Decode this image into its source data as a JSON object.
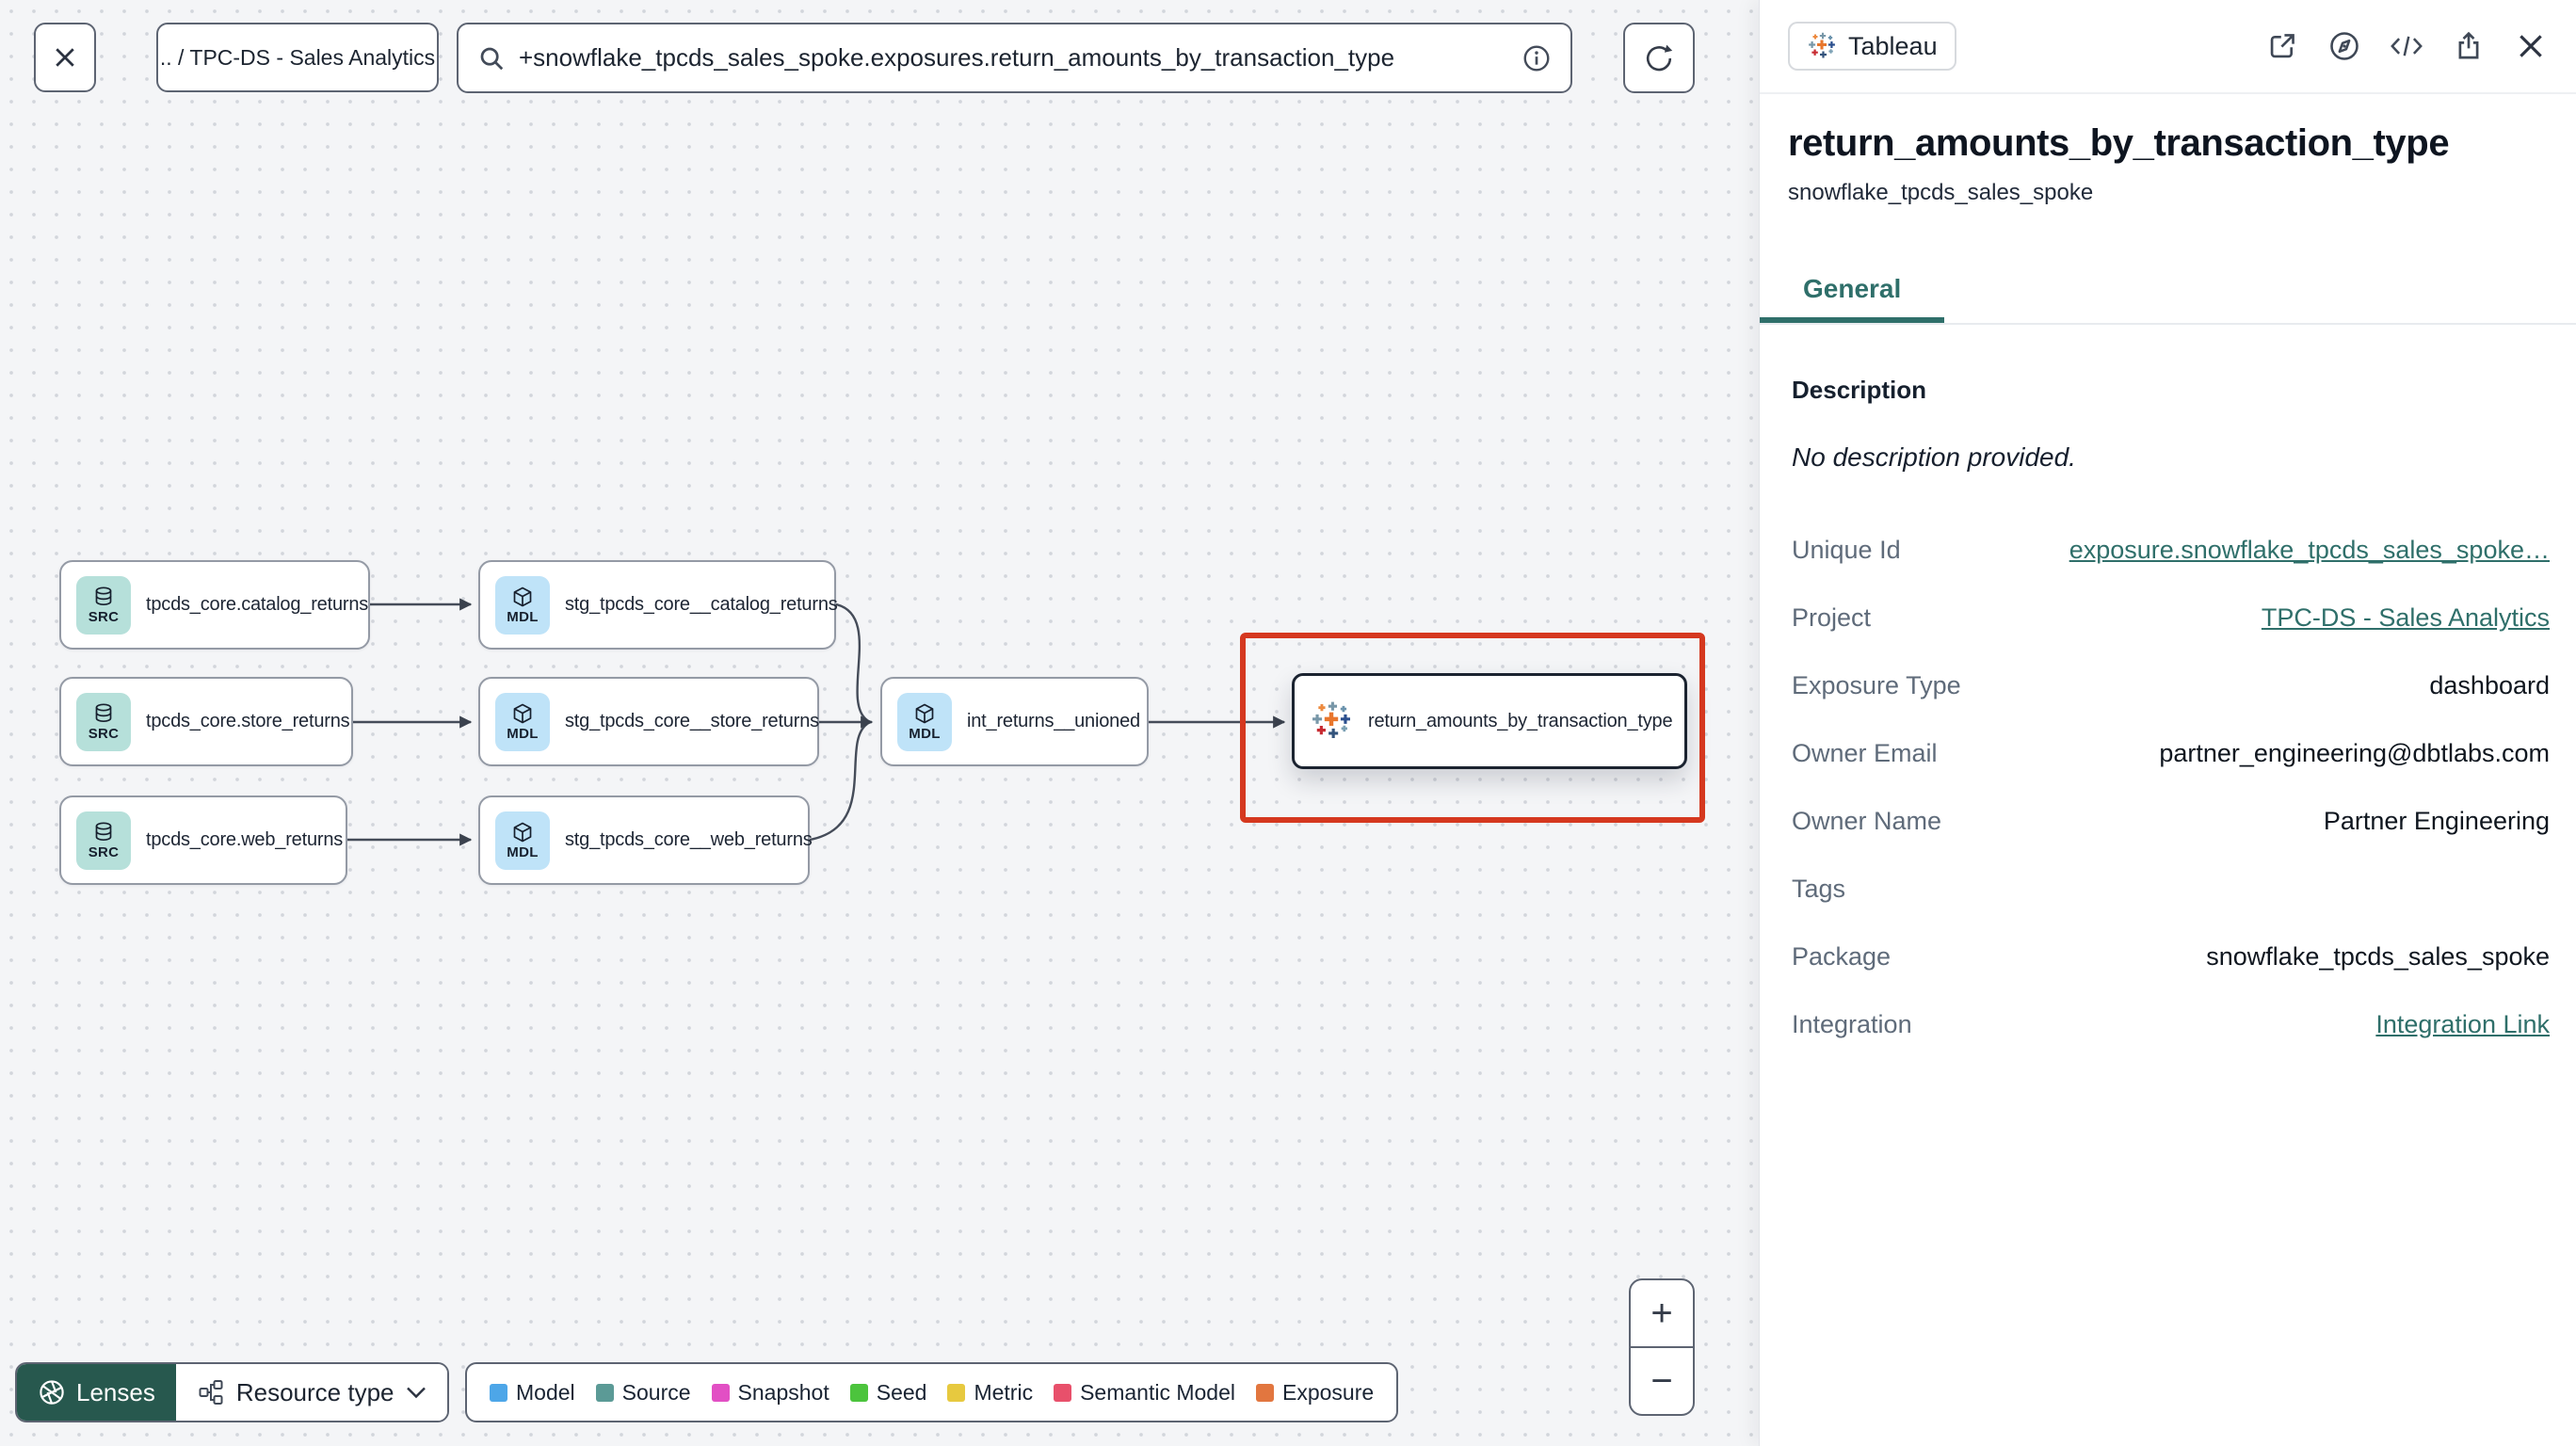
{
  "colors": {
    "accent_teal": "#2f6f6a",
    "highlight_red": "#d5381f",
    "lenses_green": "#27584e",
    "source_icon_bg": "#b6e0da",
    "model_icon_bg": "#bfe3f8"
  },
  "toolbar": {
    "breadcrumb": ".. / TPC-DS - Sales Analytics",
    "search_value": "+snowflake_tpcds_sales_spoke.exposures.return_amounts_by_transaction_type"
  },
  "graph": {
    "nodes": [
      {
        "badge": "SRC",
        "label": "tpcds_core.catalog_returns"
      },
      {
        "badge": "SRC",
        "label": "tpcds_core.store_returns"
      },
      {
        "badge": "SRC",
        "label": "tpcds_core.web_returns"
      },
      {
        "badge": "MDL",
        "label": "stg_tpcds_core__catalog_returns"
      },
      {
        "badge": "MDL",
        "label": "stg_tpcds_core__store_returns"
      },
      {
        "badge": "MDL",
        "label": "stg_tpcds_core__web_returns"
      },
      {
        "badge": "MDL",
        "label": "int_returns__unioned"
      },
      {
        "badge": "tableau",
        "label": "return_amounts_by_transaction_type"
      }
    ],
    "controls": {
      "lenses": "Lenses",
      "resource_type": "Resource type",
      "zoom_in": "+",
      "zoom_out": "−"
    },
    "legend": {
      "items": [
        {
          "label": "Model",
          "color": "#4da6e8"
        },
        {
          "label": "Source",
          "color": "#5b9a96"
        },
        {
          "label": "Snapshot",
          "color": "#e24fc4"
        },
        {
          "label": "Seed",
          "color": "#4cc43d"
        },
        {
          "label": "Metric",
          "color": "#e7c93f"
        },
        {
          "label": "Semantic Model",
          "color": "#e8506b"
        },
        {
          "label": "Exposure",
          "color": "#e2763f"
        }
      ]
    }
  },
  "panel": {
    "badge": "Tableau",
    "title": "return_amounts_by_transaction_type",
    "subtitle": "snowflake_tpcds_sales_spoke",
    "tab": "General",
    "description_label": "Description",
    "description_value": "No description provided.",
    "rows": [
      {
        "label": "Unique Id",
        "value": "exposure.snowflake_tpcds_sales_spoke…",
        "link": true
      },
      {
        "label": "Project",
        "value": "TPC-DS - Sales Analytics",
        "link": true
      },
      {
        "label": "Exposure Type",
        "value": "dashboard",
        "link": false
      },
      {
        "label": "Owner Email",
        "value": "partner_engineering@dbtlabs.com",
        "link": false
      },
      {
        "label": "Owner Name",
        "value": "Partner Engineering",
        "link": false
      },
      {
        "label": "Tags",
        "value": "",
        "link": false
      },
      {
        "label": "Package",
        "value": "snowflake_tpcds_sales_spoke",
        "link": false
      },
      {
        "label": "Integration",
        "value": "Integration Link",
        "link": true
      }
    ]
  }
}
